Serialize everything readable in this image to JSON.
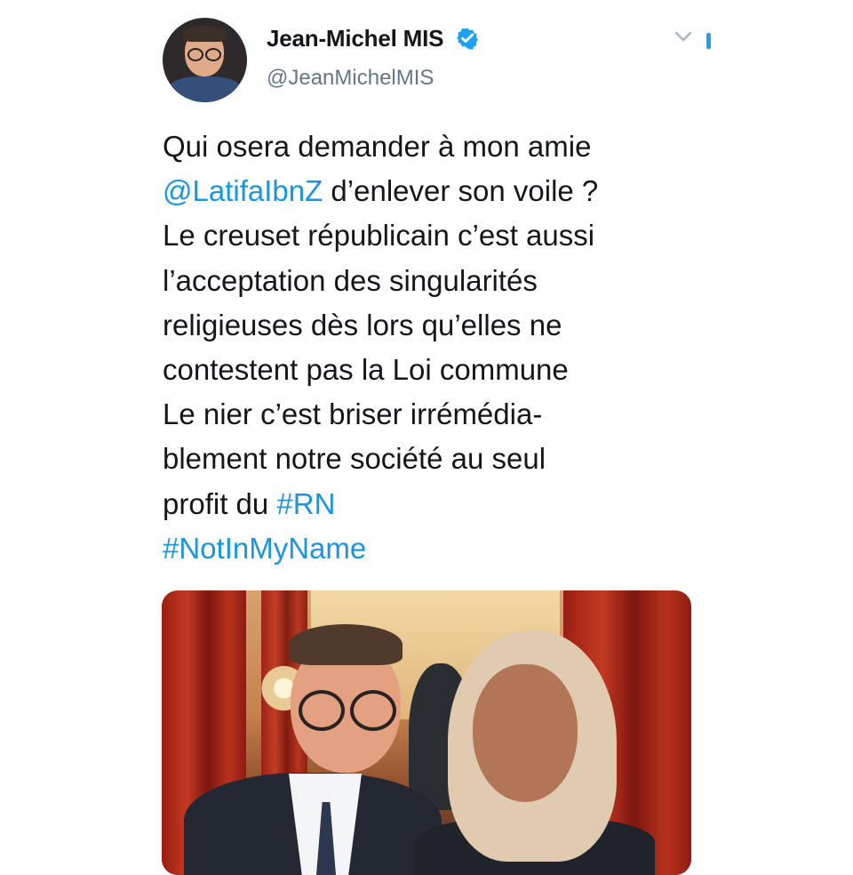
{
  "tweet": {
    "author": {
      "display_name": "Jean-Michel MIS",
      "handle": "@JeanMichelMIS",
      "avatar": "profile-photo",
      "verified_icon": "verified-badge-icon"
    },
    "menu_icon": "chevron-down-icon",
    "text_lines": [
      {
        "text": "Qui osera demander à mon amie"
      },
      {
        "mention": "@LatifaIbnZ",
        "text": " d’enlever son voile ?"
      },
      {
        "text": "Le creuset républicain c’est aussi"
      },
      {
        "text": "l’acceptation des singularités"
      },
      {
        "text": "religieuses dès lors qu’elles ne"
      },
      {
        "text": "contestent pas la Loi commune"
      },
      {
        "text": "Le nier c’est briser irrémédia-"
      },
      {
        "text": "blement notre société au seul"
      },
      {
        "text": "profit du ",
        "hashtag": "#RN"
      },
      {
        "hashtag": "#NotInMyName"
      }
    ],
    "media": {
      "type": "photo",
      "description_icon": "event-photo"
    }
  },
  "colors": {
    "link": "#1b95e0",
    "text": "#14171a",
    "secondary": "#657786",
    "verified": "#1da1f2"
  }
}
